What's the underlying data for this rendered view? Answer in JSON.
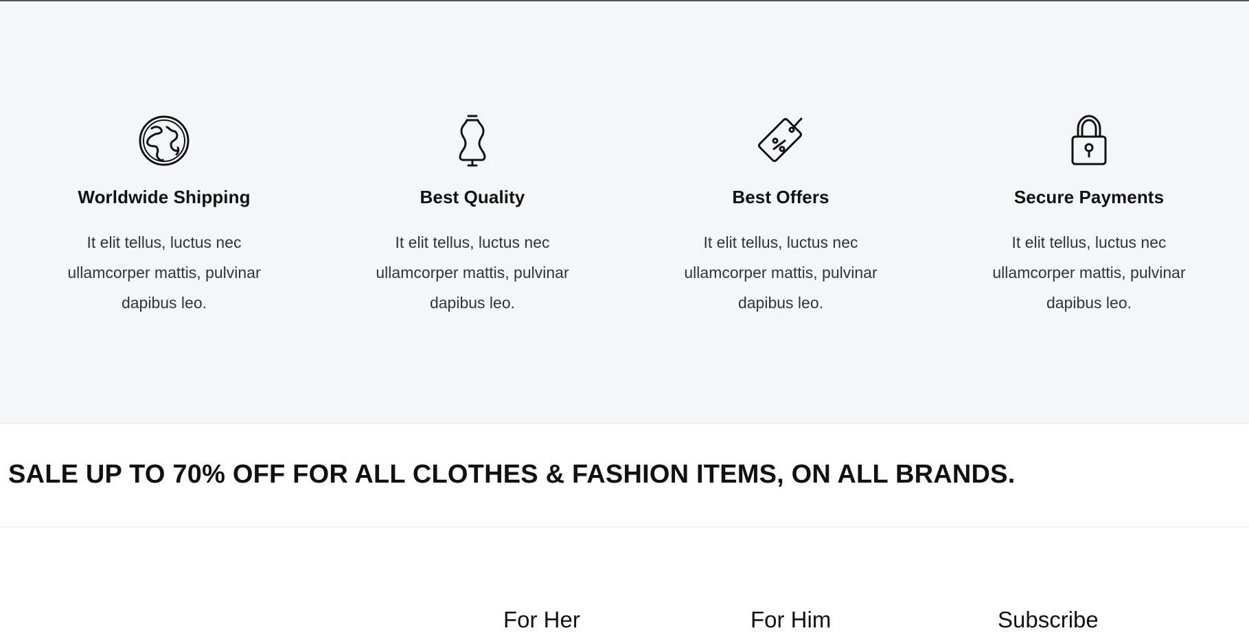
{
  "features": [
    {
      "icon": "globe-icon",
      "title": "Worldwide Shipping",
      "text": "It elit tellus, luctus nec ullamcorper mattis, pulvinar dapibus leo."
    },
    {
      "icon": "mannequin-icon",
      "title": "Best Quality",
      "text": "It elit tellus, luctus nec ullamcorper mattis, pulvinar dapibus leo."
    },
    {
      "icon": "price-tag-icon",
      "title": "Best Offers",
      "text": "It elit tellus, luctus nec ullamcorper mattis, pulvinar dapibus leo."
    },
    {
      "icon": "padlock-icon",
      "title": "Secure Payments",
      "text": "It elit tellus, luctus nec ullamcorper mattis, pulvinar dapibus leo."
    }
  ],
  "sale": {
    "headline": "SALE UP TO 70% OFF FOR ALL CLOTHES & FASHION ITEMS, ON ALL BRANDS."
  },
  "footer": {
    "columns": [
      {
        "title": "For Her"
      },
      {
        "title": "For Him"
      },
      {
        "title": "Subscribe"
      }
    ]
  },
  "colors": {
    "features_bg": "#f5f6f8",
    "text": "#111111",
    "body_text": "#333333"
  }
}
